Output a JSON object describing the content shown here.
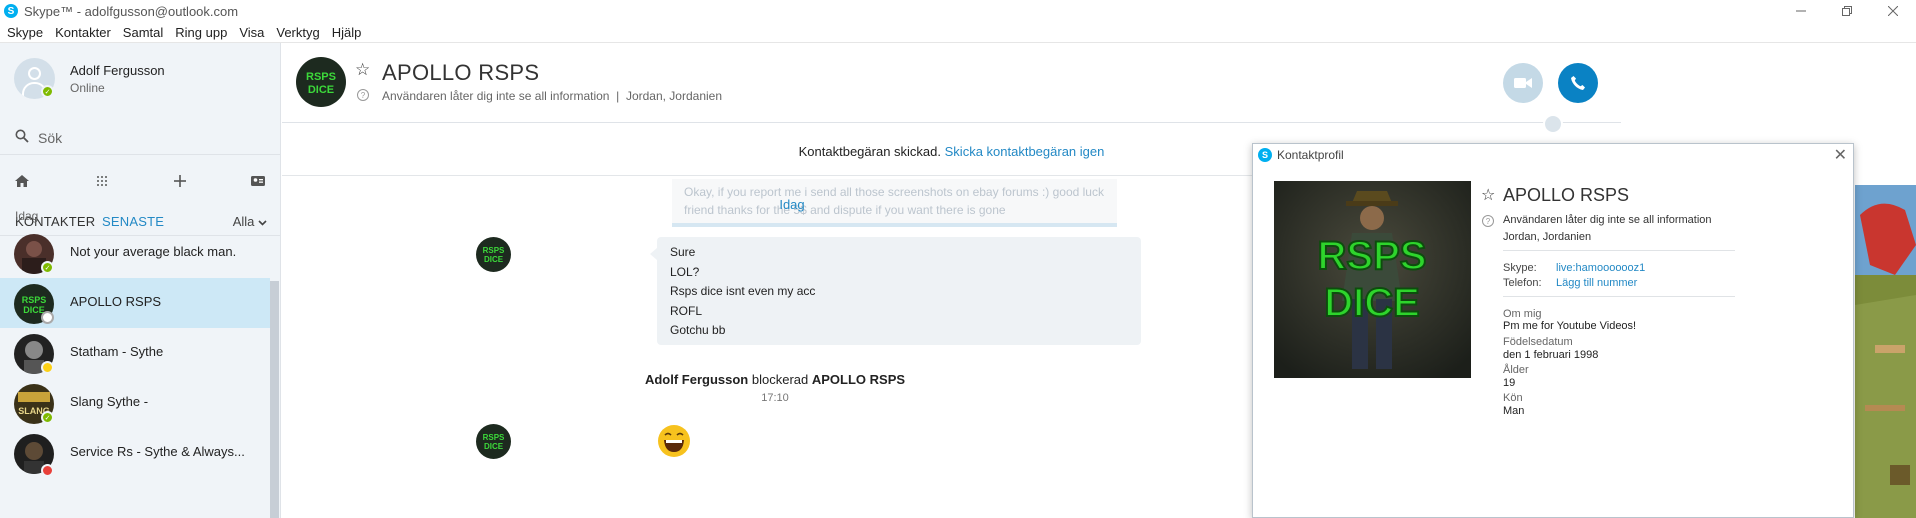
{
  "window": {
    "title": "Skype™ - adolfgusson@outlook.com",
    "icon": "skype-icon",
    "controls": [
      "minimize-icon",
      "maximize-icon",
      "close-icon"
    ]
  },
  "menu": [
    "Skype",
    "Kontakter",
    "Samtal",
    "Ring upp",
    "Visa",
    "Verktyg",
    "Hjälp"
  ],
  "sidebar": {
    "profile": {
      "name": "Adolf Fergusson",
      "status": "Online"
    },
    "search": {
      "placeholder": "Sök"
    },
    "tools": [
      "home-icon",
      "dialpad-icon",
      "add-icon",
      "contacts-card-icon"
    ],
    "tabs": {
      "contacts": "KONTAKTER",
      "recent": "SENASTE",
      "filter": "Alla"
    },
    "section_label": "Idag",
    "conversations": [
      {
        "name": "Not your average black man.",
        "status": "online"
      },
      {
        "name": "APOLLO RSPS",
        "status": "offline",
        "selected": true
      },
      {
        "name": "Statham - Sythe",
        "status": "away"
      },
      {
        "name": "Slang Sythe -",
        "status": "online"
      },
      {
        "name": "Service Rs - Sythe & Always...",
        "status": "busy"
      }
    ]
  },
  "conversation": {
    "name": "APOLLO RSPS",
    "info_note": "Användaren låter dig inte se all information",
    "location": "Jordan, Jordanien",
    "request_text": "Kontaktbegäran skickad.",
    "request_link": "Skicka kontaktbegäran igen",
    "faded_message": "Okay, if you report me i send all those screenshots on ebay forums :) good luck friend thanks for the 5$ and dispute if you want there is gone",
    "day_label": "Idag",
    "messages": [
      "Sure",
      "LOL?",
      "Rsps dice isnt even my acc",
      "ROFL",
      "Gotchu bb"
    ],
    "system": {
      "actor": "Adolf Fergusson",
      "action": "blockerad",
      "target": "APOLLO RSPS",
      "time": "17:10"
    },
    "emoticon": "laughing-emoticon"
  },
  "profile_window": {
    "title": "Kontaktprofil",
    "name": "APOLLO RSPS",
    "info_note": "Användaren låter dig inte se all information",
    "location": "Jordan, Jordanien",
    "skype_label": "Skype:",
    "skype_value": "live:hamooooooz1",
    "phone_label": "Telefon:",
    "phone_value": "Lägg till nummer",
    "about_label": "Om mig",
    "about_value": "Pm me for Youtube Videos!",
    "birth_label": "Födelsedatum",
    "birth_value": "den 1 februari 1998",
    "age_label": "Ålder",
    "age_value": "19",
    "gender_label": "Kön",
    "gender_value": "Man",
    "photo_text": [
      "RSPS",
      "DICE"
    ]
  },
  "colors": {
    "accent": "#2389c5",
    "call": "#0a82c4",
    "sidebar_bg": "#f0f4f8",
    "selected_row": "#cde8f6",
    "bubble": "#eef2f5"
  }
}
